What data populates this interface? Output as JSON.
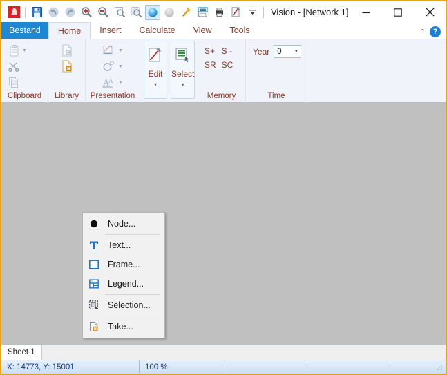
{
  "window": {
    "title": "Vision - [Network 1]",
    "border_color": "#e8a317",
    "minimize_label": "—",
    "maximize_label": "□",
    "close_label": "✕"
  },
  "quick_access_toolbar": {
    "items": [
      {
        "name": "app-logo-icon",
        "tooltip": "Vision"
      },
      {
        "name": "save-icon",
        "tooltip": "Save"
      },
      {
        "name": "undo-icon",
        "tooltip": "Undo"
      },
      {
        "name": "redo-icon",
        "tooltip": "Redo"
      },
      {
        "name": "zoom-in-icon",
        "tooltip": "Zoom In"
      },
      {
        "name": "zoom-out-icon",
        "tooltip": "Zoom Out"
      },
      {
        "name": "zoom-window-icon",
        "tooltip": "Zoom Window"
      },
      {
        "name": "zoom-all-icon",
        "tooltip": "Zoom All"
      },
      {
        "name": "node-on-icon",
        "tooltip": "Show Nodes"
      },
      {
        "name": "node-off-icon",
        "tooltip": "Hide Nodes"
      },
      {
        "name": "pin-icon",
        "tooltip": "Pin"
      },
      {
        "name": "print-preview-icon",
        "tooltip": "Print Preview"
      },
      {
        "name": "print-icon",
        "tooltip": "Print"
      },
      {
        "name": "edit-icon",
        "tooltip": "Edit"
      },
      {
        "name": "customize-caret-icon",
        "tooltip": "Customize Quick Access Toolbar"
      }
    ]
  },
  "tabs": {
    "items": [
      {
        "label": "Bestand",
        "state": "file"
      },
      {
        "label": "Home",
        "state": "active"
      },
      {
        "label": "Insert",
        "state": "normal"
      },
      {
        "label": "Calculate",
        "state": "normal"
      },
      {
        "label": "View",
        "state": "normal"
      },
      {
        "label": "Tools",
        "state": "normal"
      }
    ],
    "collapse_label": "⌃",
    "help_label": "?"
  },
  "ribbon": {
    "groups": [
      {
        "title": "Clipboard",
        "items": [
          {
            "label": "Paste",
            "icon": "paste-icon",
            "caret": true
          },
          {
            "label": "Cut",
            "icon": "cut-icon",
            "caret": false
          },
          {
            "label": "Copy",
            "icon": "copy-icon",
            "caret": false
          }
        ]
      },
      {
        "title": "Library",
        "items": [
          {
            "label": "Library Open",
            "icon": "library-open-icon",
            "caret": false
          },
          {
            "label": "Library Save",
            "icon": "library-save-icon",
            "caret": false
          }
        ]
      },
      {
        "title": "Presentation",
        "items": [
          {
            "label": "Presentation Edit",
            "icon": "presentation-edit-icon",
            "caret": true
          },
          {
            "label": "Presentation Node",
            "icon": "presentation-node-icon",
            "caret": true
          },
          {
            "label": "Presentation Text",
            "icon": "presentation-text-icon",
            "caret": true
          }
        ]
      },
      {
        "title": "",
        "big_buttons": [
          {
            "label": "Edit",
            "icon": "edit-big-icon",
            "caret": "▾"
          },
          {
            "label": "Select",
            "icon": "select-big-icon",
            "caret": "▾"
          }
        ]
      },
      {
        "title": "Memory",
        "buttons": [
          "S+",
          "S -",
          "SR",
          "SC"
        ]
      },
      {
        "title": "Time",
        "year_label": "Year",
        "year_value": "0"
      }
    ]
  },
  "context_menu": {
    "items": [
      {
        "label": "Node...",
        "icon": "node-circle-icon",
        "separator_after": true
      },
      {
        "label": "Text...",
        "icon": "text-t-icon",
        "separator_after": false
      },
      {
        "label": "Frame...",
        "icon": "frame-square-icon",
        "separator_after": false
      },
      {
        "label": "Legend...",
        "icon": "legend-grid-icon",
        "separator_after": true
      },
      {
        "label": "Selection...",
        "icon": "selection-marquee-icon",
        "separator_after": true
      },
      {
        "label": "Take...",
        "icon": "take-document-icon",
        "separator_after": false
      }
    ]
  },
  "sheet_tabs": {
    "items": [
      {
        "label": "Sheet 1",
        "active": true
      }
    ]
  },
  "statusbar": {
    "coordinates": "X: 14773, Y: 15001",
    "zoom": "100 %",
    "cell3": "",
    "cell4": "",
    "cell5": ""
  }
}
